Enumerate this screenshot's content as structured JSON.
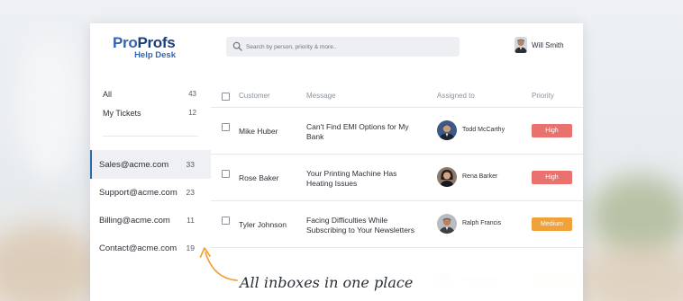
{
  "brand": {
    "pro": "Pro",
    "profs": "Profs",
    "sub": "Help Desk"
  },
  "search": {
    "placeholder": "Search by person, priority & more..",
    "icon": "search-icon"
  },
  "user": {
    "name": "Will Smith"
  },
  "sidebar": {
    "top_items": [
      {
        "label": "All",
        "count": "43"
      },
      {
        "label": "My Tickets",
        "count": "12"
      }
    ],
    "inboxes": [
      {
        "label": "Sales@acme.com",
        "count": "33",
        "active": true
      },
      {
        "label": "Support@acme.com",
        "count": "23",
        "active": false
      },
      {
        "label": "Billing@acme.com",
        "count": "11",
        "active": false
      },
      {
        "label": "Contact@acme.com",
        "count": "19",
        "active": false
      }
    ]
  },
  "table": {
    "headers": {
      "customer": "Customer",
      "message": "Message",
      "assigned": "Assigned to",
      "priority": "Priority"
    },
    "rows": [
      {
        "customer": "Mike Huber",
        "message": "Can't Find EMI Options for My Bank",
        "agent": "Todd McCarthy",
        "priority": "High",
        "priority_color": "#e9726f"
      },
      {
        "customer": "Rose Baker",
        "message": "Your Printing Machine Has Heating Issues",
        "agent": "Rena Barker",
        "priority": "High",
        "priority_color": "#e9726f"
      },
      {
        "customer": "Tyler Johnson",
        "message": "Facing Difficulties While Subscribing to Your Newsletters",
        "agent": "Ralph Francis",
        "priority": "Medium",
        "priority_color": "#f0a23a"
      }
    ]
  },
  "callout": {
    "text": "All inboxes in one place"
  },
  "colors": {
    "accent": "#2e66b1",
    "high": "#e9726f",
    "medium": "#f0a23a"
  }
}
